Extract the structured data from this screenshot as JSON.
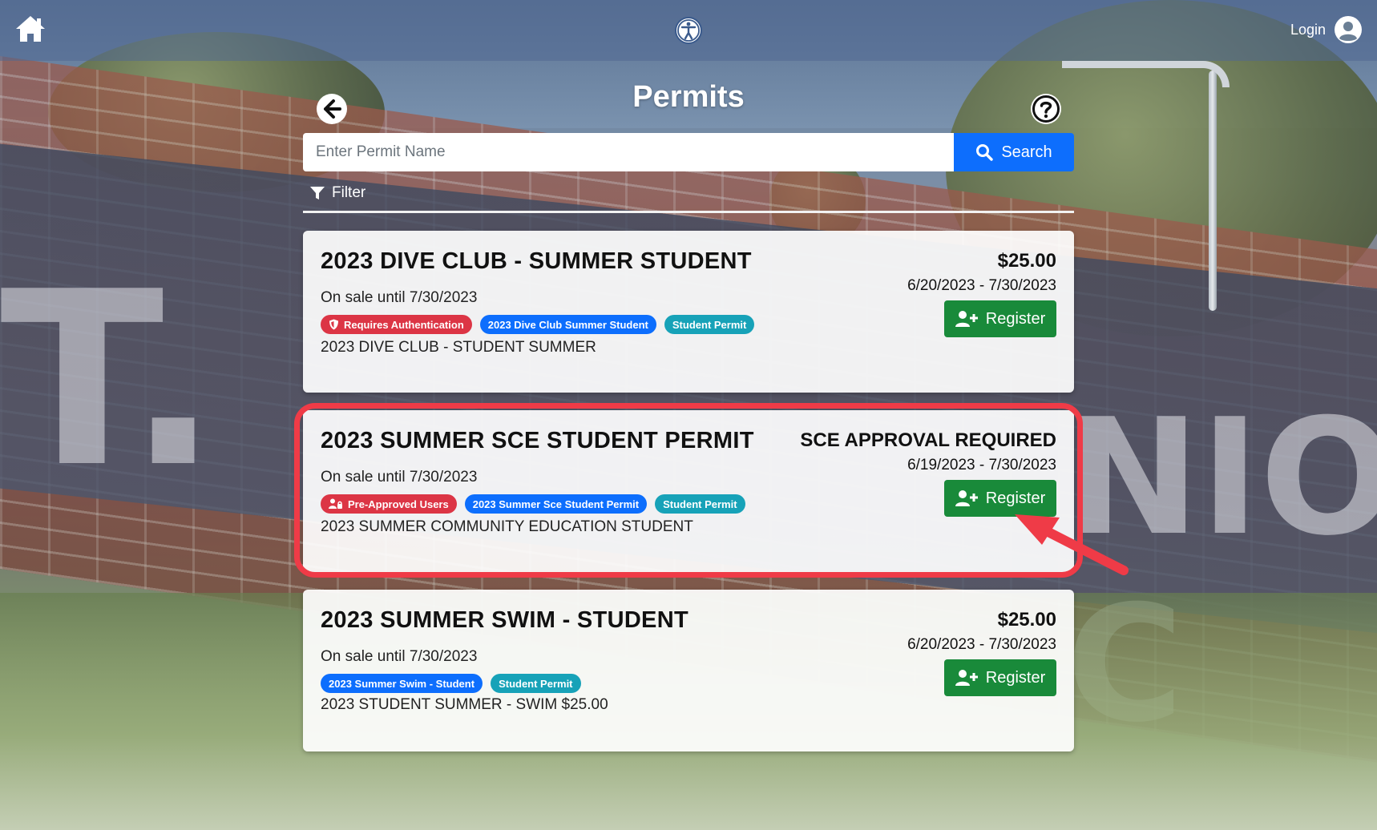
{
  "topbar": {
    "home_icon": "home-icon",
    "accessibility_icon": "accessibility-icon",
    "login_label": "Login",
    "user_icon": "user-circle-icon"
  },
  "header": {
    "title": "Permits",
    "back_icon": "arrow-left-circle-icon",
    "help_icon": "question-circle-icon"
  },
  "search": {
    "placeholder": "Enter Permit Name",
    "value": "",
    "button_label": "Search",
    "button_icon": "search-icon"
  },
  "filter": {
    "label": "Filter",
    "icon": "funnel-icon"
  },
  "colors": {
    "primary": "#0d6efd",
    "success": "#198a3a",
    "danger": "#dc3545",
    "info": "#17a2b8",
    "highlight": "#ef3b47"
  },
  "permits": [
    {
      "title": "2023 DIVE CLUB - SUMMER STUDENT",
      "sale": "On sale until 7/30/2023",
      "tags": [
        {
          "label": "Requires Authentication",
          "color": "red",
          "icon": "shield-icon"
        },
        {
          "label": "2023 Dive Club Summer Student",
          "color": "blue"
        },
        {
          "label": "Student Permit",
          "color": "teal"
        }
      ],
      "description": "2023 DIVE CLUB - STUDENT SUMMER",
      "price": "$25.00",
      "dates": "6/20/2023 - 7/30/2023",
      "register_label": "Register"
    },
    {
      "title": "2023 SUMMER SCE STUDENT PERMIT",
      "sale": "On sale until 7/30/2023",
      "tags": [
        {
          "label": "Pre-Approved Users",
          "color": "red",
          "icon": "users-lock-icon"
        },
        {
          "label": "2023 Summer Sce Student Permit",
          "color": "blue"
        },
        {
          "label": "Student Permit",
          "color": "teal"
        }
      ],
      "description": "2023 SUMMER COMMUNITY EDUCATION STUDENT",
      "price": "SCE APPROVAL REQUIRED",
      "dates": "6/19/2023 - 7/30/2023",
      "register_label": "Register",
      "highlighted": true
    },
    {
      "title": "2023 SUMMER SWIM - STUDENT",
      "sale": "On sale until 7/30/2023",
      "tags": [
        {
          "label": "2023 Summer Swim - Student",
          "color": "blue"
        },
        {
          "label": "Student Permit",
          "color": "teal"
        }
      ],
      "description": "2023 STUDENT SUMMER - SWIM $25.00",
      "price": "$25.00",
      "dates": "6/20/2023 - 7/30/2023",
      "register_label": "Register"
    }
  ]
}
